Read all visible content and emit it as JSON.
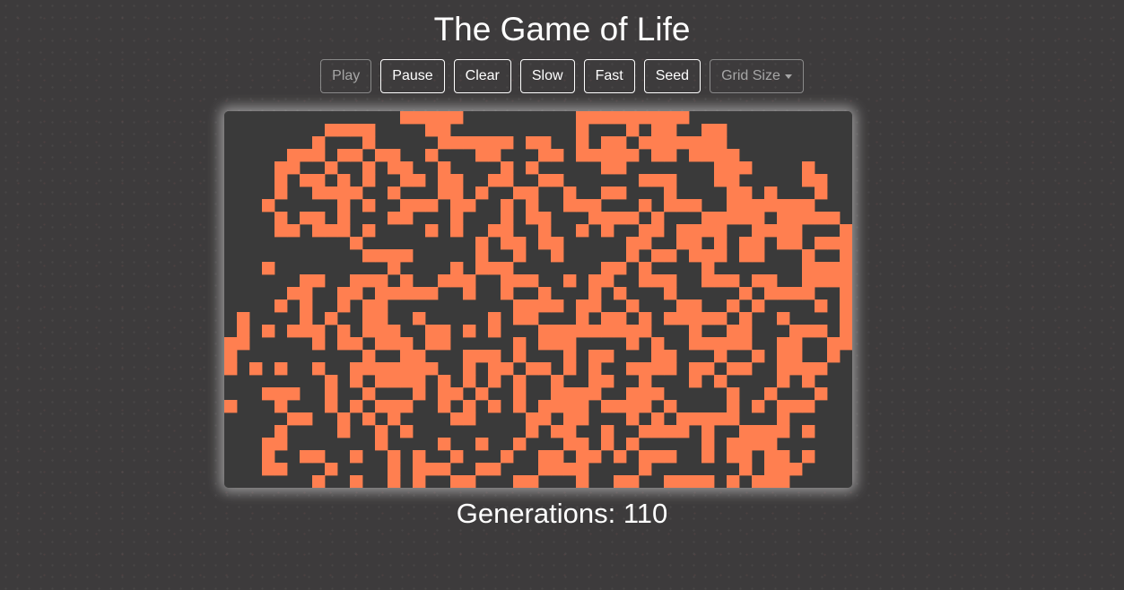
{
  "app": {
    "title": "The Game of Life"
  },
  "toolbar": {
    "buttons": [
      {
        "label": "Play",
        "disabled": true
      },
      {
        "label": "Pause",
        "disabled": false
      },
      {
        "label": "Clear",
        "disabled": false
      },
      {
        "label": "Slow",
        "disabled": false
      },
      {
        "label": "Fast",
        "disabled": false
      },
      {
        "label": "Seed",
        "disabled": false
      }
    ],
    "grid_size_label": "Grid Size",
    "grid_size_disabled": true
  },
  "board": {
    "columns": 50,
    "rows": 30,
    "live_color": "#ff7f50",
    "dead_color": "#3a3a3a",
    "live_rows": [
      "..............#####.........#########.............",
      "........####....##..........#...#.##..##..........",
      ".......#...#.....######.##..#.##.#######..........",
      ".....###.##.##..#...##...##.#####.##.####.........",
      "....##..#..#.##..#....#.#.....##.......###....#...",
      "....#.##.#.#..##.##..##..##......###...##.....##..",
      "....#..####..#...##.#..##..#..##...#....##.#...#..",
      "...#.....#.#..###.##..#.#..###...#.###..#######...",
      "....#.##.#...##...#...#.##...####.#...#####.#####.",
      "....##.###.#....#.#..##..#..#.#..##.####..####...#",
      "..........#.........#.##.##.....##..##.#.##.##.###",
      "...........####.....#..#..#.....#.##.###.##...#..#",
      "...#.........#....#.###.......##.#....#.......####",
      "......##..###.#..###..###..#.##..###..###.##..####",
      ".....##..##.#####..#..#..#...#.#...#.....#.####..#",
      "....#.#..#.##..........####.##..#...##..#.#....#.#",
      ".#....#.#..##..#.....#.##...#.##.#.#####.#..#....#",
      ".#.#.###.#.###..##.#.#...#########...#..##...###.#",
      "##.....#.##.###.##.....#.###....#.#..#####..##..##",
      "#..........#..##...###.#...#.##...##...#..#.##..#.",
      "#.#.#..#..#######..#.##.##.#.#..####.##.##..####..",
      "........#.#.####.#.#.#.#..#..##..#...#.#....#.#...",
      "...###..#..#...#.##.#..#..####..###.....#..#...#..",
      "#...#...#.#.###..#.#.#.#.####.####.#....#.#.###...",
      ".....##..#.#.#....##....##.##...#.#.#####...#.....",
      "....#....#..#.#.........#.##..#..####.#..####.#...",
      "...##.......#....#..#..#...##.#.#.....#.####......",
      "...#..##..#..#.#..#...#..##.##.#.###..#.##.##.#...",
      "...##...#....#.###..##...####....#.......#.###....",
      ".......#..#..#.#..##...##...#..##..####.#.###.....",
      "...#...##.##...#...#.#.#...##.......#..#.#........"
    ]
  },
  "status": {
    "generations_label": "Generations:",
    "generations_value": "110"
  }
}
